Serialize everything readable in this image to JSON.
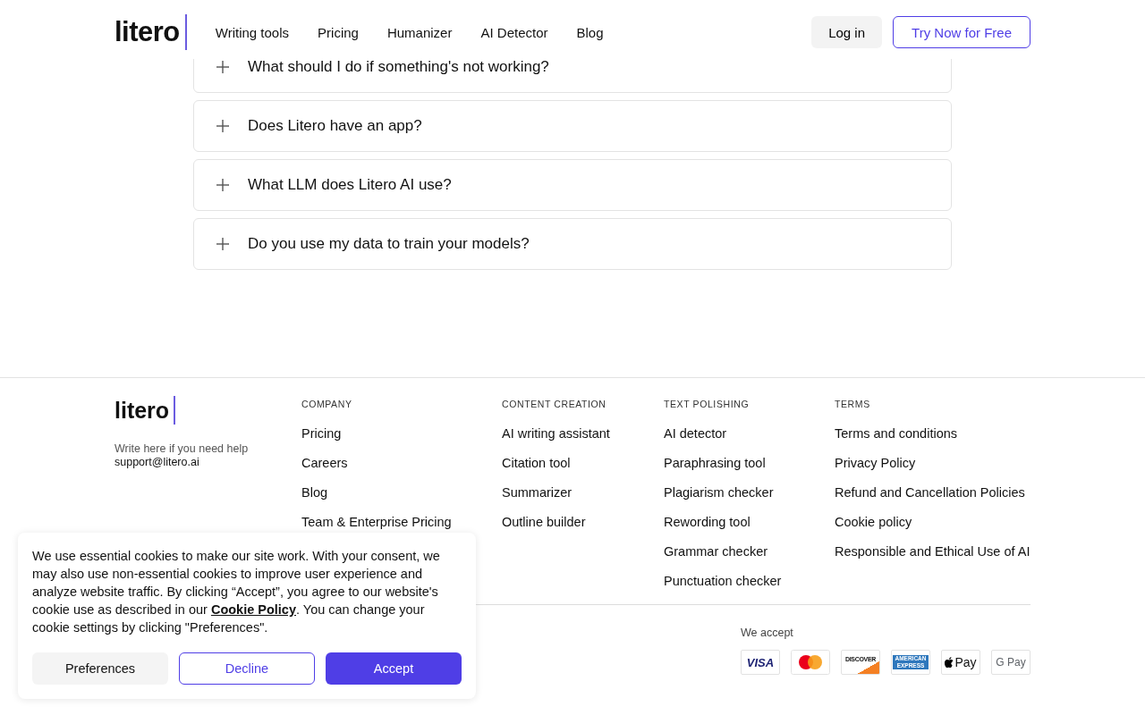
{
  "header": {
    "logo": "litero",
    "nav": [
      "Writing tools",
      "Pricing",
      "Humanizer",
      "AI Detector",
      "Blog"
    ],
    "login": "Log in",
    "cta": "Try Now for Free"
  },
  "faq": [
    {
      "question": "What should I do if something's not working?",
      "expanded": false
    },
    {
      "question": "Does Litero have an app?",
      "expanded": false
    },
    {
      "question": "What LLM does Litero AI use?",
      "expanded": false
    },
    {
      "question": "Do you use my data to train your models?",
      "expanded": false
    }
  ],
  "footer": {
    "logo": "litero",
    "help_text": "Write here if you need help",
    "email": "support@litero.ai",
    "columns": [
      {
        "heading": "COMPANY",
        "links": [
          "Pricing",
          "Careers",
          "Blog",
          "Team & Enterprise Pricing"
        ]
      },
      {
        "heading": "CONTENT CREATION",
        "links": [
          "AI writing assistant",
          "Citation tool",
          "Summarizer",
          "Outline builder"
        ]
      },
      {
        "heading": "TEXT POLISHING",
        "links": [
          "AI detector",
          "Paraphrasing tool",
          "Plagiarism checker",
          "Rewording tool",
          "Grammar checker",
          "Punctuation checker"
        ]
      },
      {
        "heading": "TERMS",
        "links": [
          "Terms and conditions",
          "Privacy Policy",
          "Refund and Cancellation Policies",
          "Cookie policy",
          "Responsible and Ethical Use of AI"
        ]
      }
    ],
    "payments_label": "We accept",
    "payments": [
      {
        "kind": "visa",
        "label": "VISA"
      },
      {
        "kind": "mastercard"
      },
      {
        "kind": "discover",
        "label": "DISCOVER"
      },
      {
        "kind": "amex",
        "label": "AMERICAN EXPRESS"
      },
      {
        "kind": "applepay",
        "label": "Pay"
      },
      {
        "kind": "googlepay",
        "label": "G Pay"
      }
    ]
  },
  "cookie_banner": {
    "text_before": "We use essential cookies to make our site work. With your consent, we may also use non-essential cookies to improve user experience and analyze website traffic. By clicking “Accept”, you agree to our website's cookie use as described in our",
    "link": "Cookie Policy",
    "text_after": ". You can change your cookie settings by clicking \"Preferences\".",
    "buttons": [
      "Preferences",
      "Decline",
      "Accept"
    ]
  }
}
